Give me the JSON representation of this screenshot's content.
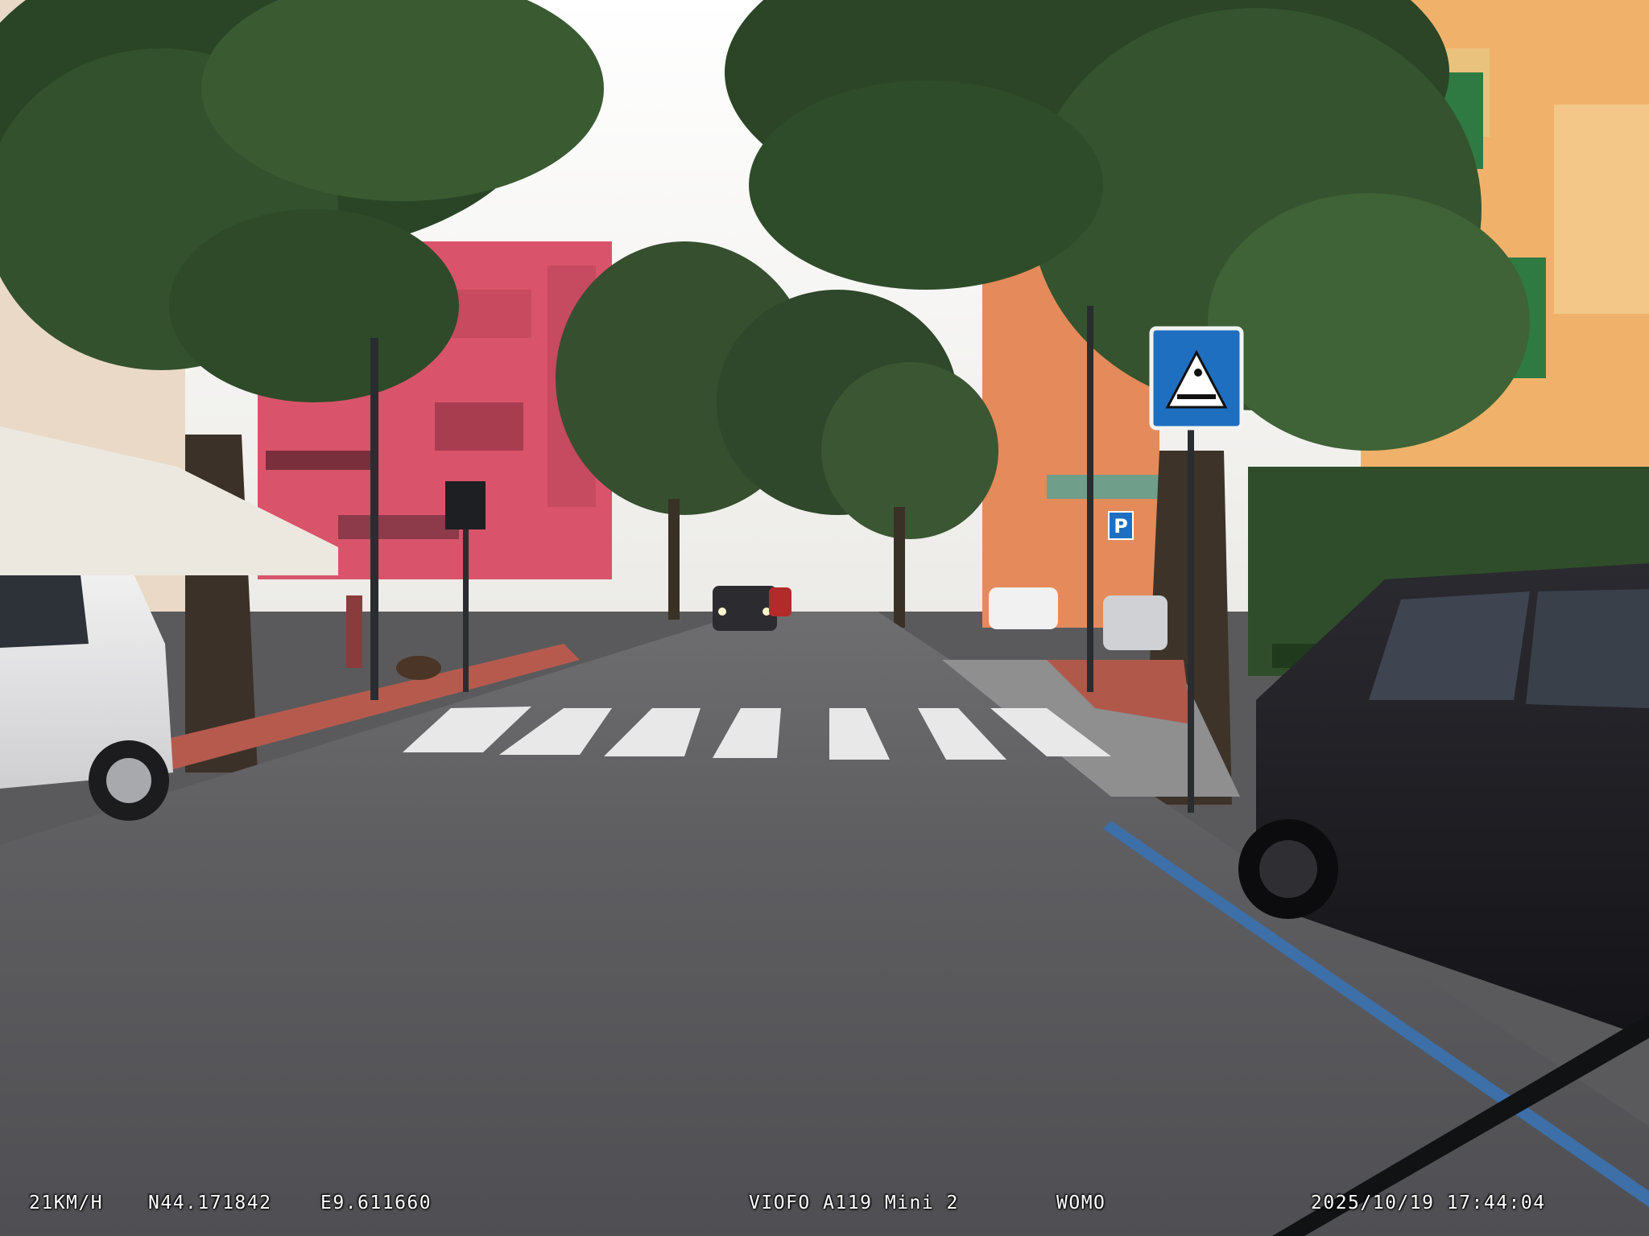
{
  "overlay": {
    "speed": "21KM/H",
    "latitude": "N44.171842",
    "longitude": "E9.611660",
    "camera_model": "VIOFO A119 Mini 2",
    "tag": "WOMO",
    "timestamp": "2025/10/19 17:44:04"
  },
  "scene": {
    "sign_pedestrian_crossing": "pedestrian-crossing",
    "sign_parking": "P",
    "colors": {
      "sky": "#f2f1ee",
      "road": "#5b5b5e",
      "foliage": "#2f4a2a",
      "pink_building": "#d9546a",
      "yellow_building": "#f0b26a",
      "sign_blue": "#1f6fc0",
      "crosswalk": "#e8e8e8",
      "osd_text": "#ffffff"
    }
  }
}
